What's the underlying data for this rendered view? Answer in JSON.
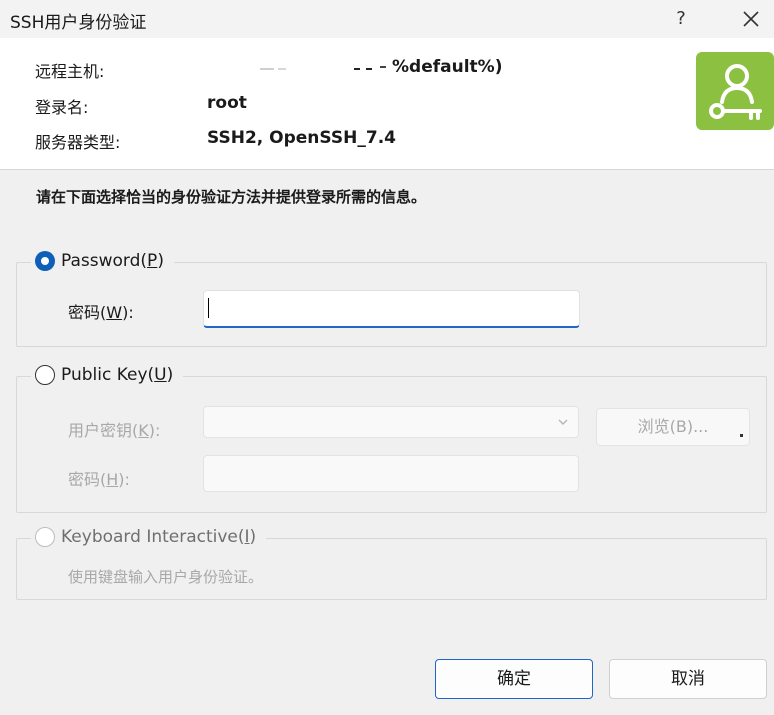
{
  "window": {
    "title": "SSH用户身份验证",
    "help_label": "?"
  },
  "header": {
    "host_label": "远程主机:",
    "host_value": "%default%)",
    "login_label": "登录名:",
    "login_value": "root",
    "server_type_label": "服务器类型:",
    "server_type_value": "SSH2, OpenSSH_7.4",
    "accent_color": "#8cc040",
    "avatar_icon": "user-key-icon"
  },
  "instruction": "请在下面选择恰当的身份验证方法并提供登录所需的信息。",
  "password_method": {
    "label": "Password(P)",
    "label_main": "Password(",
    "label_mnemonic": "P",
    "label_end": ")",
    "selected": true,
    "field_label_main": "密码(",
    "field_label_mnemonic": "W",
    "field_label_end": "):",
    "field_value": ""
  },
  "publickey_method": {
    "label_main": "Public Key(",
    "label_mnemonic": "U",
    "label_end": ")",
    "selected": false,
    "key_label_main": "用户密钥(",
    "key_label_mnemonic": "K",
    "key_label_end": "):",
    "key_value": "",
    "browse_label": "浏览(B)...",
    "pass_label_main": "密码(",
    "pass_label_mnemonic": "H",
    "pass_label_end": "):",
    "pass_value": ""
  },
  "keyboard_method": {
    "label_main": "Keyboard Interactive(",
    "label_mnemonic": "I",
    "label_end": ")",
    "selected": false,
    "description": "使用键盘输入用户身份验证。"
  },
  "buttons": {
    "ok_label": "确定",
    "cancel_label": "取消"
  }
}
